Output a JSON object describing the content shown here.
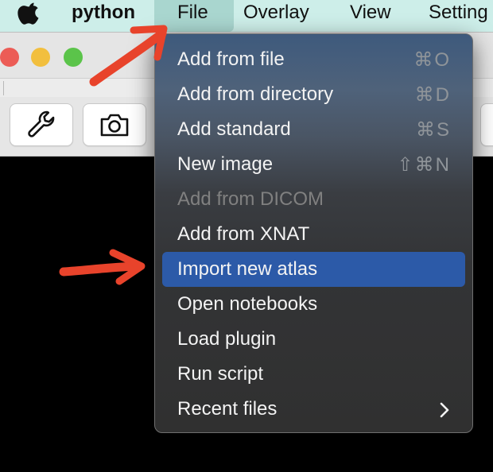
{
  "menubar": {
    "app_name": "python",
    "items": [
      "File",
      "Overlay",
      "View",
      "Setting"
    ]
  },
  "toolbar": {
    "buttons": [
      "wrench-icon",
      "camera-icon"
    ]
  },
  "file_menu": {
    "items": [
      {
        "label": "Add from file",
        "shortcut": "⌘O",
        "enabled": true
      },
      {
        "label": "Add from directory",
        "shortcut": "⌘D",
        "enabled": true
      },
      {
        "label": "Add standard",
        "shortcut": "⌘S",
        "enabled": true
      },
      {
        "label": "New image",
        "shortcut": "⇧⌘N",
        "enabled": true
      },
      {
        "label": "Add from DICOM",
        "shortcut": "",
        "enabled": false
      },
      {
        "label": "Add from XNAT",
        "shortcut": "",
        "enabled": true
      },
      {
        "label": "Import new atlas",
        "shortcut": "",
        "enabled": true,
        "highlighted": true
      },
      {
        "label": "Open notebooks",
        "shortcut": "",
        "enabled": true
      },
      {
        "label": "Load plugin",
        "shortcut": "",
        "enabled": true
      },
      {
        "label": "Run script",
        "shortcut": "",
        "enabled": true
      },
      {
        "label": "Recent files",
        "shortcut": "",
        "enabled": true,
        "submenu": true
      }
    ]
  },
  "colors": {
    "menubar_bg": "#cdeee9",
    "highlight": "#2c5aa8",
    "annotation_arrow": "#e8432b"
  }
}
